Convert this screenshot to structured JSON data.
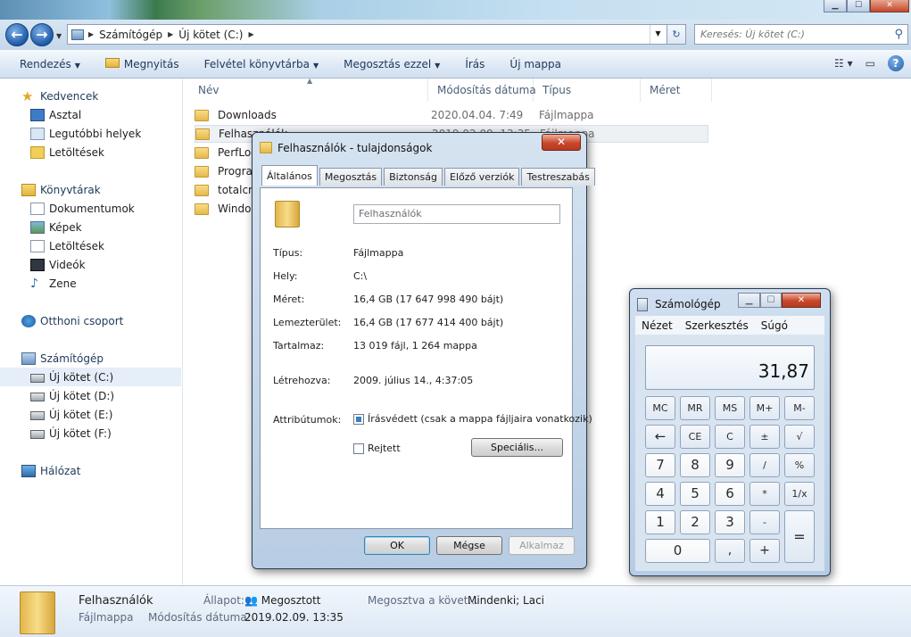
{
  "explorer": {
    "window_controls": {
      "minimize": "▁",
      "maximize": "☐",
      "close": "✕"
    },
    "back_symbol": "←",
    "forward_symbol": "→",
    "breadcrumb": [
      "Számítógép",
      "Új kötet (C:)"
    ],
    "search_placeholder": "Keresés: Új kötet (C:)",
    "toolbar": {
      "organize": "Rendezés",
      "open": "Megnyitás",
      "include_library": "Felvétel könyvtárba",
      "share_with": "Megosztás ezzel",
      "burn": "Írás",
      "new_folder": "Új mappa"
    },
    "nav": {
      "favorites": "Kedvencek",
      "desktop": "Asztal",
      "recent": "Legutóbbi helyek",
      "downloads": "Letöltések",
      "libraries": "Könyvtárak",
      "documents": "Dokumentumok",
      "pictures": "Képek",
      "lib_downloads": "Letöltések",
      "videos": "Videók",
      "music": "Zene",
      "homegroup": "Otthoni csoport",
      "computer": "Számítógép",
      "drive_c": "Új kötet (C:)",
      "drive_d": "Új kötet (D:)",
      "drive_e": "Új kötet (E:)",
      "drive_f": "Új kötet (F:)",
      "network": "Hálózat"
    },
    "columns": {
      "name": "Név",
      "modified": "Módosítás dátuma",
      "type": "Típus",
      "size": "Méret"
    },
    "files": [
      {
        "name": "Downloads",
        "modified": "2020.04.04. 7:49",
        "type": "Fájlmappa"
      },
      {
        "name": "Felhasználók",
        "modified": "2019.02.09. 13:35",
        "type": "Fájlmappa"
      },
      {
        "name": "PerfLogs",
        "modified": "",
        "type": ""
      },
      {
        "name": "Program Files",
        "modified": "",
        "type": ""
      },
      {
        "name": "totalcmd",
        "modified": "",
        "type": ""
      },
      {
        "name": "Windows",
        "modified": "",
        "type": ""
      }
    ],
    "details": {
      "name": "Felhasználók",
      "type": "Fájlmappa",
      "state_label": "Állapot:",
      "state_value": "Megosztott",
      "modified_label": "Módosítás dátuma:",
      "modified_value": "2019.02.09. 13:35",
      "shared_label": "Megosztva a követ...",
      "shared_value": "Mindenki; Laci"
    }
  },
  "properties": {
    "title": "Felhasználók - tulajdonságok",
    "close": "✕",
    "tabs": [
      "Általános",
      "Megosztás",
      "Biztonság",
      "Előző verziók",
      "Testreszabás"
    ],
    "name_value": "Felhasználók",
    "rows": [
      {
        "label": "Típus:",
        "value": "Fájlmappa"
      },
      {
        "label": "Hely:",
        "value": "C:\\"
      },
      {
        "label": "Méret:",
        "value": "16,4 GB (17 647 998 490 bájt)"
      },
      {
        "label": "Lemezterület:",
        "value": "16,4 GB (17 677 414 400 bájt)"
      },
      {
        "label": "Tartalmaz:",
        "value": "13 019 fájl, 1 264 mappa"
      }
    ],
    "created_label": "Létrehozva:",
    "created_value": "2009. július 14., 4:37:05",
    "attributes_label": "Attribútumok:",
    "readonly_label": "Írásvédett (csak a mappa fájljaira vonatkozik)",
    "hidden_label": "Rejtett",
    "advanced_button": "Speciális...",
    "ok": "OK",
    "cancel": "Mégse",
    "apply": "Alkalmaz"
  },
  "calculator": {
    "title": "Számológép",
    "controls": {
      "minimize": "▁",
      "maximize": "☐",
      "close": "✕"
    },
    "menu": [
      "Nézet",
      "Szerkesztés",
      "Súgó"
    ],
    "display": "31,87",
    "keys": [
      [
        "MC",
        "MR",
        "MS",
        "M+",
        "M-"
      ],
      [
        "←",
        "CE",
        "C",
        "±",
        "√"
      ],
      [
        "7",
        "8",
        "9",
        "/",
        "%"
      ],
      [
        "4",
        "5",
        "6",
        "*",
        "1/x"
      ],
      [
        "1",
        "2",
        "3",
        "-",
        "="
      ],
      [
        "0",
        ",",
        "+"
      ]
    ]
  }
}
